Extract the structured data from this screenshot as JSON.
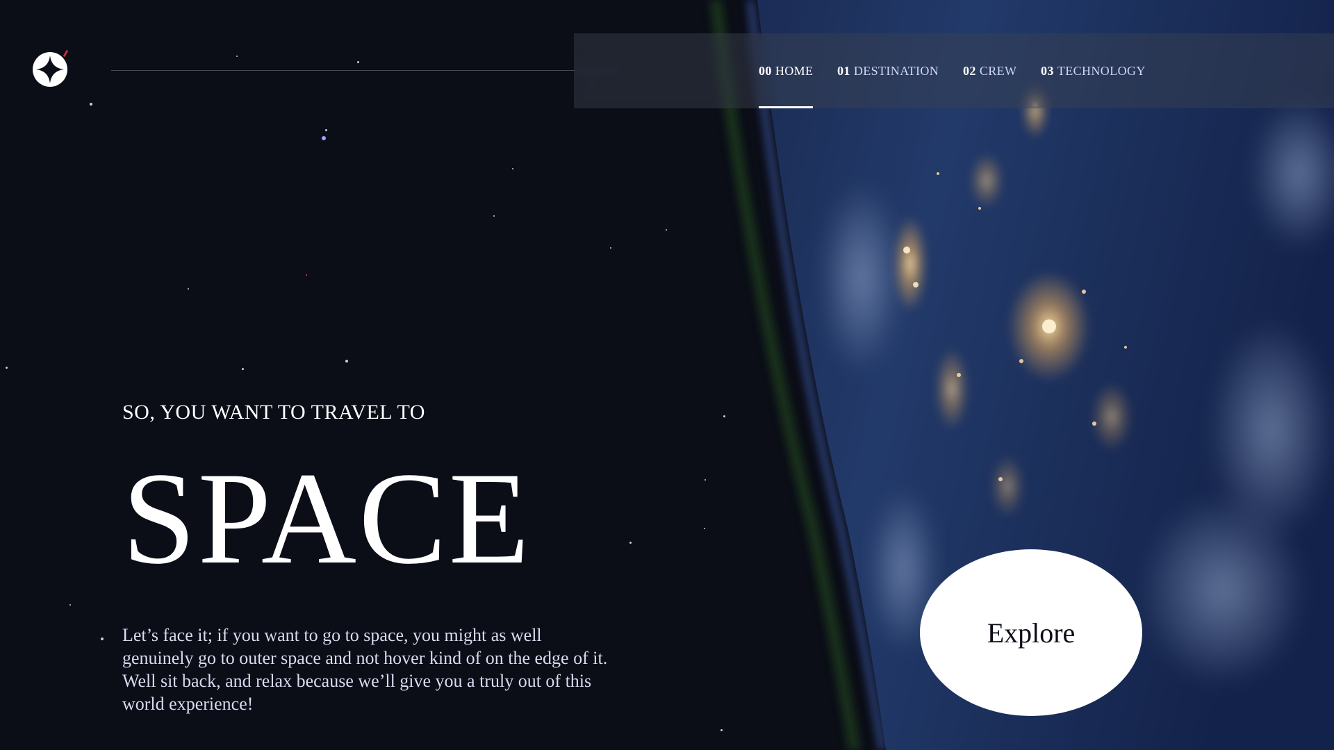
{
  "nav": {
    "items": [
      {
        "num": "00",
        "label": "HOME",
        "active": true
      },
      {
        "num": "01",
        "label": "DESTINATION",
        "active": false
      },
      {
        "num": "02",
        "label": "CREW",
        "active": false
      },
      {
        "num": "03",
        "label": "TECHNOLOGY",
        "active": false
      }
    ]
  },
  "hero": {
    "eyebrow": "SO, YOU WANT TO TRAVEL TO",
    "title": "SPACE",
    "body": "Let’s face it; if you want to go to space, you might as well genuinely go to outer space and not hover kind of on the edge of it. Well sit back, and relax because we’ll give you a truly out of this world experience!",
    "cta_label": "Explore"
  },
  "icons": {
    "logo": "four-point-star-logo-icon"
  },
  "colors": {
    "background": "#0b0d17",
    "text": "#ffffff",
    "muted_text": "#d0d6f9",
    "button": "#ffffff"
  }
}
